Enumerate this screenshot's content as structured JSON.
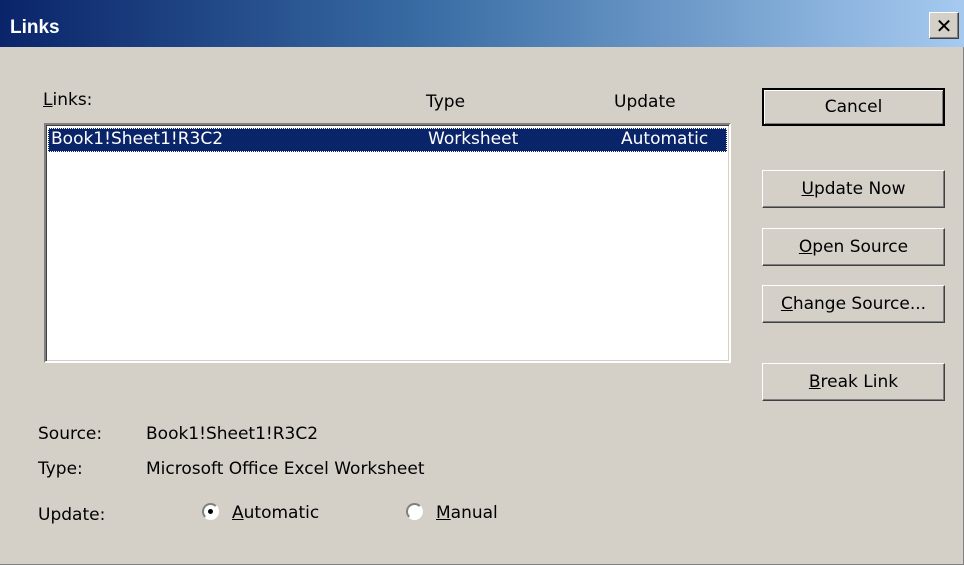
{
  "window": {
    "title": "Links",
    "close_glyph": "✕"
  },
  "list": {
    "label_mnemonic": "L",
    "label_rest": "inks:",
    "col_type": "Type",
    "col_update": "Update",
    "rows": [
      {
        "link": "Book1!Sheet1!R3C2",
        "type": "Worksheet",
        "update": "Automatic",
        "selected": true
      }
    ]
  },
  "buttons": {
    "cancel": "Cancel",
    "update_now_mnemonic": "U",
    "update_now_rest": "pdate Now",
    "open_source_mnemonic": "O",
    "open_source_rest": "pen Source",
    "change_source_mnemonic": "C",
    "change_source_rest": "hange Source...",
    "break_link_mnemonic": "B",
    "break_link_rest": "reak Link"
  },
  "details": {
    "source_label": "Source:",
    "source_value": "Book1!Sheet1!R3C2",
    "type_label": "Type:",
    "type_value": "Microsoft Office Excel Worksheet",
    "update_label": "Update:",
    "automatic_mnemonic": "A",
    "automatic_rest": "utomatic",
    "manual_mnemonic": "M",
    "manual_rest": "anual",
    "selected_update": "Automatic"
  },
  "colors": {
    "face": "#d4d0c8",
    "title_start": "#0a246a",
    "title_end": "#a6caf0",
    "selection": "#0a246a"
  }
}
